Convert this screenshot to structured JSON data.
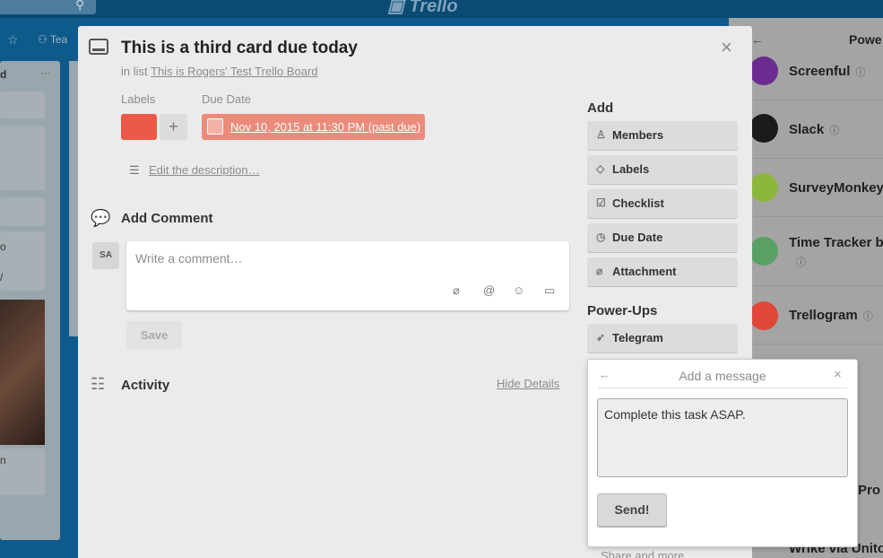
{
  "background": {
    "team_label": "Tea",
    "list1": {
      "title": "d",
      "menu": "···",
      "cards": [
        "",
        "o",
        "/",
        "n"
      ]
    }
  },
  "sidebar": {
    "title": "Powe",
    "back": "←",
    "items": [
      {
        "name": "Screenful",
        "icon_color": "#6a2c91",
        "info": "ⓘ"
      },
      {
        "name": "Slack",
        "icon_color": "#1a1a1a",
        "info": "ⓘ"
      },
      {
        "name": "SurveyMonkey",
        "icon_color": "#8db63c",
        "info": ""
      },
      {
        "name": "Time Tracker b",
        "icon_color": "#5aa064",
        "info": "ⓘ"
      },
      {
        "name": "Trellogram",
        "icon_color": "#e0463a",
        "info": "ⓘ"
      },
      {
        "name": "",
        "icon_color": "#a4a4a4",
        "info": ""
      },
      {
        "name": "",
        "icon_color": "#a4a4a4",
        "info": ""
      },
      {
        "name": "Pro",
        "icon_color": "#a4a4a4",
        "info": ""
      },
      {
        "name": "Wrike via Unito",
        "icon_color": "#3a9d3a",
        "info": ""
      }
    ]
  },
  "card": {
    "title": "This is a third card due today",
    "in_list_prefix": "in list",
    "list_name": "This is Rogers' Test Trello Board",
    "labels_heading": "Labels",
    "due_heading": "Due Date",
    "label_color": "#eb5a46",
    "add_label": "+",
    "due_text": "Nov 10, 2015 at 11:30 PM (past due)",
    "edit_description": "Edit the description…",
    "close": "×"
  },
  "comment": {
    "heading": "Add Comment",
    "avatar": "SA",
    "placeholder": "Write a comment…",
    "save": "Save",
    "tools": [
      "attachment-icon",
      "mention-icon",
      "emoji-icon",
      "card-icon"
    ]
  },
  "activity": {
    "heading": "Activity",
    "hide_details": "Hide Details"
  },
  "side": {
    "add_heading": "Add",
    "buttons": [
      {
        "label": "Members",
        "icon": "person-icon"
      },
      {
        "label": "Labels",
        "icon": "tag-icon"
      },
      {
        "label": "Checklist",
        "icon": "checkbox-icon"
      },
      {
        "label": "Due Date",
        "icon": "clock-icon"
      },
      {
        "label": "Attachment",
        "icon": "paperclip-icon"
      }
    ],
    "powerups_heading": "Power-Ups",
    "telegram": "Telegram",
    "share_more": "Share and more…"
  },
  "popover": {
    "back": "←",
    "title": "Add a message",
    "close": "×",
    "message": "Complete this task ASAP.",
    "send": "Send!"
  }
}
